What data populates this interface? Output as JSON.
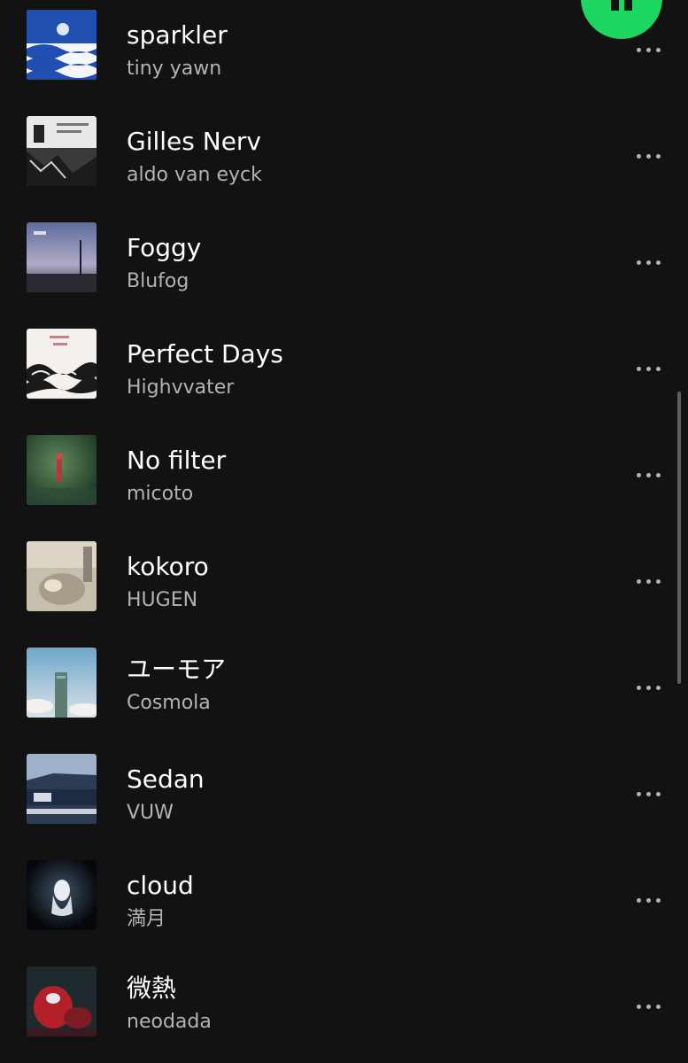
{
  "player": {
    "pause_icon": "pause-icon",
    "accent": "#1ed760"
  },
  "colors": {
    "background": "#121212",
    "title": "#ffffff",
    "subtitle": "#b3b3b3"
  },
  "tracks": [
    {
      "title": "sparkler",
      "artist": "tiny yawn",
      "more_icon": "more-horizontal-icon"
    },
    {
      "title": "Gilles Nerv",
      "artist": "aldo van eyck",
      "more_icon": "more-horizontal-icon"
    },
    {
      "title": "Foggy",
      "artist": "Blufog",
      "more_icon": "more-horizontal-icon"
    },
    {
      "title": "Perfect Days",
      "artist": "Highvvater",
      "more_icon": "more-horizontal-icon"
    },
    {
      "title": "No filter",
      "artist": "micoto",
      "more_icon": "more-horizontal-icon"
    },
    {
      "title": "kokoro",
      "artist": "HUGEN",
      "more_icon": "more-horizontal-icon"
    },
    {
      "title": "ユーモア",
      "artist": "Cosmola",
      "more_icon": "more-horizontal-icon"
    },
    {
      "title": "Sedan",
      "artist": "VUW",
      "more_icon": "more-horizontal-icon"
    },
    {
      "title": "cloud",
      "artist": "満月",
      "more_icon": "more-horizontal-icon"
    },
    {
      "title": "微熱",
      "artist": "neodada",
      "more_icon": "more-horizontal-icon"
    }
  ]
}
